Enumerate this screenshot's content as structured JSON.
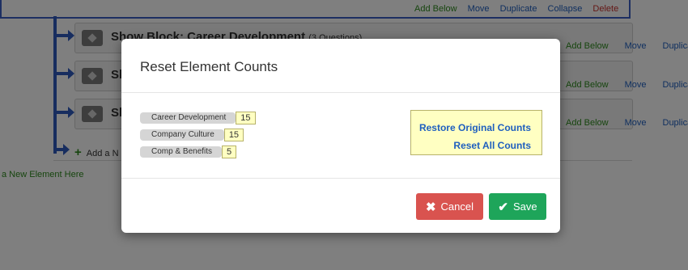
{
  "background": {
    "top_actions": [
      "Add Below",
      "Move",
      "Duplicate",
      "Collapse",
      "Delete"
    ],
    "blocks": [
      {
        "title": "Show Block: Career Development",
        "count": "(3 Questions)"
      },
      {
        "title": "Sh",
        "count": ""
      },
      {
        "title": "Sh",
        "count": ""
      }
    ],
    "row_actions": [
      "Add Below",
      "Move",
      "Duplicate"
    ],
    "add_inner": "Add a N",
    "add_outer": "a New Element Here"
  },
  "modal": {
    "title": "Reset Element Counts",
    "counts": [
      {
        "label": "Career Development",
        "value": "15"
      },
      {
        "label": "Company Culture",
        "value": "15"
      },
      {
        "label": "Comp & Benefits",
        "value": "5"
      }
    ],
    "restore_label": "Restore Original Counts",
    "reset_label": "Reset All Counts",
    "cancel_label": "Cancel",
    "save_label": "Save"
  },
  "colors": {
    "link_blue": "#1f5fbf",
    "add_green": "#2e8b1e",
    "delete_red": "#c9302c",
    "cancel_red": "#d9534f",
    "save_green": "#1ea55a",
    "highlight_yellow": "#ffffc2"
  }
}
